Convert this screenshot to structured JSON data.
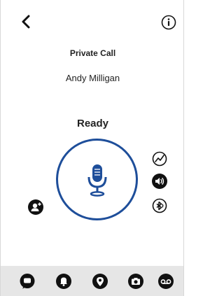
{
  "header": {
    "back_icon": "chevron-left-icon",
    "info_icon": "info-icon"
  },
  "call": {
    "type_label": "Private Call",
    "contact_name": "Andy Milligan",
    "status": "Ready"
  },
  "ptt": {
    "icon": "microphone-icon"
  },
  "side_controls": {
    "add_user_icon": "add-user-icon",
    "signal_icon": "signal-icon",
    "speaker_icon": "speaker-icon",
    "bluetooth_icon": "bluetooth-audio-icon"
  },
  "bottom_tabs": [
    {
      "icon": "chat-icon"
    },
    {
      "icon": "alert-icon"
    },
    {
      "icon": "location-icon"
    },
    {
      "icon": "camera-icon"
    },
    {
      "icon": "voicemail-icon"
    }
  ],
  "colors": {
    "accent": "#1e4e9a",
    "icon": "#111111",
    "bottom_bar": "#e6e6e6",
    "text": "#222222"
  }
}
